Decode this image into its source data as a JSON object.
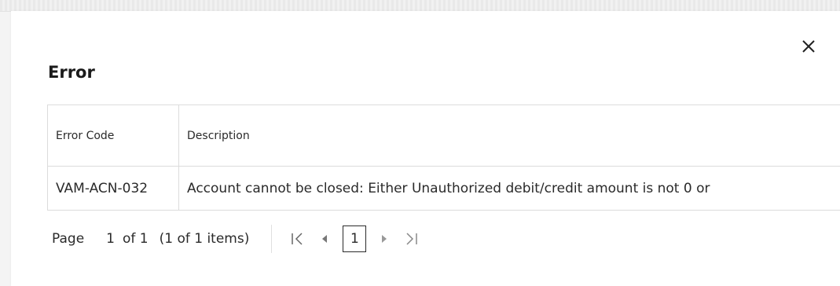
{
  "dialog": {
    "title": "Error",
    "close_icon": "close-icon"
  },
  "table": {
    "headers": [
      "Error Code",
      "Description"
    ],
    "rows": [
      {
        "code": "VAM-ACN-032",
        "description": "Account cannot be closed: Either Unauthorized debit/credit amount is not 0 or"
      }
    ]
  },
  "pager": {
    "page_label": "Page",
    "current_page": "1",
    "of_label": "of 1",
    "items_label": "(1 of 1 items)",
    "page_button": "1",
    "icons": [
      "first-page-icon",
      "prev-page-icon",
      "next-page-icon",
      "last-page-icon"
    ]
  }
}
